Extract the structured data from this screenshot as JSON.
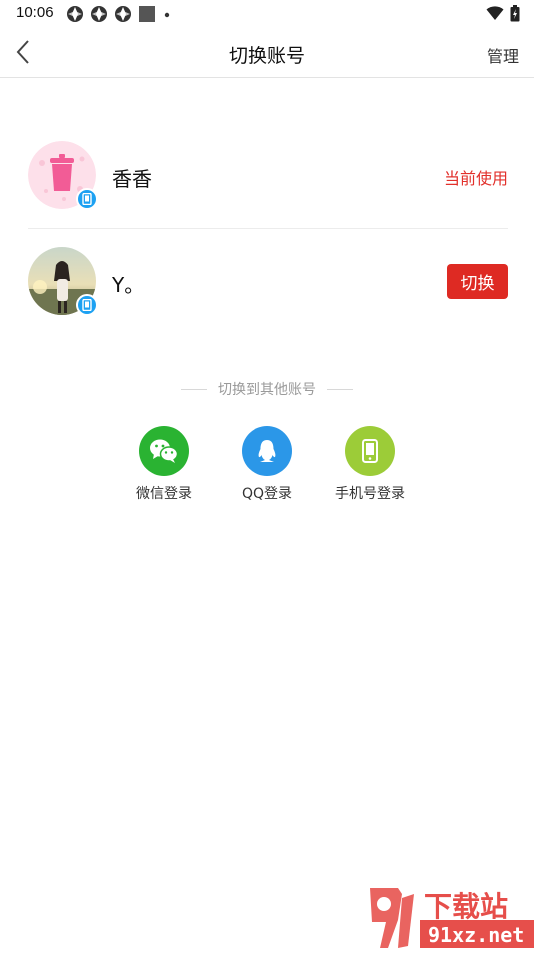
{
  "status_bar": {
    "time": "10:06"
  },
  "header": {
    "title": "切换账号",
    "manage_label": "管理"
  },
  "accounts": [
    {
      "name": "香香",
      "status_label": "当前使用",
      "avatar_icon": "pink-trash-avatar"
    },
    {
      "name": "Y。",
      "action_label": "切换",
      "avatar_icon": "photo-avatar"
    }
  ],
  "other_accounts": {
    "title": "切换到其他账号",
    "options": [
      {
        "label": "微信登录",
        "icon": "wechat-icon",
        "color": "#2ab332"
      },
      {
        "label": "QQ登录",
        "icon": "qq-icon",
        "color": "#2b97e8"
      },
      {
        "label": "手机号登录",
        "icon": "phone-icon",
        "color": "#9ccc38"
      }
    ]
  },
  "watermark": {
    "brand_chars": "下载站",
    "site": "91xz.net"
  },
  "colors": {
    "accent_red": "#de2a23",
    "badge_blue": "#1da1f2"
  }
}
